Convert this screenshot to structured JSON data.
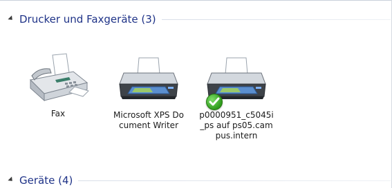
{
  "groups": [
    {
      "title": "Drucker und Faxgeräte (3)",
      "expanded": true
    },
    {
      "title": "Geräte (4)",
      "expanded": true
    }
  ],
  "devices": [
    {
      "label": "Fax",
      "icon": "fax-machine-icon"
    },
    {
      "label": "Microsoft XPS Document Writer",
      "icon": "printer-icon"
    },
    {
      "label": "p0000951_c5045i_ps auf ps05.campus.intern",
      "icon": "printer-icon",
      "default": true,
      "badge_icon": "default-printer-check-icon"
    }
  ],
  "colors": {
    "group_title": "#1e3287",
    "check": "#2f9b1c"
  }
}
